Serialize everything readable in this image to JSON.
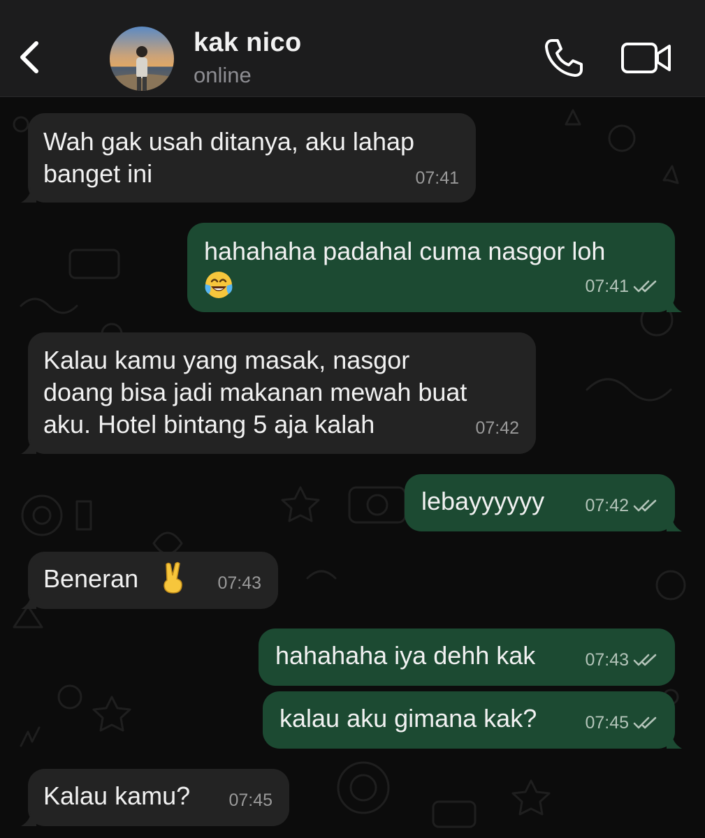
{
  "header": {
    "contact_name": "kak nico",
    "status": "online",
    "back_icon": "chevron-left-icon",
    "call_icon": "phone-icon",
    "video_icon": "video-camera-icon"
  },
  "messages": [
    {
      "direction": "incoming",
      "text": "Wah gak usah ditanya, aku lahap\nbanget ini",
      "time": "07:41"
    },
    {
      "direction": "outgoing",
      "text": "hahahaha padahal cuma nasgor loh",
      "emoji": "face-with-tears-of-joy",
      "time": "07:41",
      "status": "read"
    },
    {
      "direction": "incoming",
      "text": "Kalau kamu yang masak, nasgor\ndoang bisa jadi makanan mewah buat\naku. Hotel bintang 5 aja kalah",
      "time": "07:42"
    },
    {
      "direction": "outgoing",
      "text": "lebayyyyyy",
      "time": "07:42",
      "status": "read"
    },
    {
      "direction": "incoming",
      "text": "Beneran",
      "emoji": "victory-hand",
      "time": "07:43"
    },
    {
      "direction": "outgoing",
      "text": "hahahaha iya dehh kak",
      "time": "07:43",
      "status": "read"
    },
    {
      "direction": "outgoing",
      "text": "kalau aku gimana kak?",
      "time": "07:45",
      "status": "read"
    },
    {
      "direction": "incoming",
      "text": "Kalau kamu?",
      "time": "07:45"
    }
  ],
  "colors": {
    "header_bg": "#1c1c1d",
    "incoming_bubble": "#232323",
    "outgoing_bubble": "#1c4a32",
    "timestamp": "#9a9a9a",
    "status_text": "#8d8d92"
  }
}
